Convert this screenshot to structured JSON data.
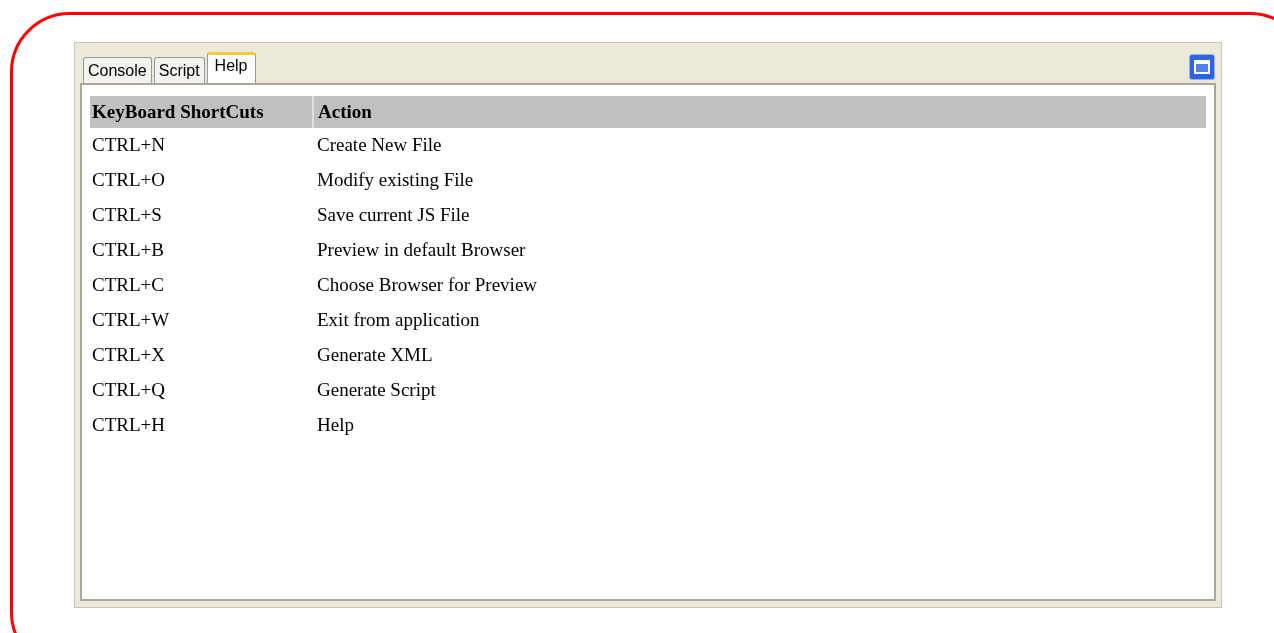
{
  "tabs": [
    {
      "label": "Console",
      "selected": false
    },
    {
      "label": "Script",
      "selected": false
    },
    {
      "label": "Help",
      "selected": true
    }
  ],
  "table": {
    "columns": [
      "KeyBoard ShortCuts",
      "Action"
    ],
    "rows": [
      [
        "CTRL+N",
        "Create New File"
      ],
      [
        "CTRL+O",
        "Modify existing File"
      ],
      [
        "CTRL+S",
        "Save current JS File"
      ],
      [
        "CTRL+B",
        "Preview in default Browser"
      ],
      [
        "CTRL+C",
        "Choose Browser for Preview"
      ],
      [
        "CTRL+W",
        "Exit from application"
      ],
      [
        "CTRL+X",
        "Generate XML"
      ],
      [
        "CTRL+Q",
        "Generate Script"
      ],
      [
        "CTRL+H",
        "Help"
      ]
    ]
  }
}
